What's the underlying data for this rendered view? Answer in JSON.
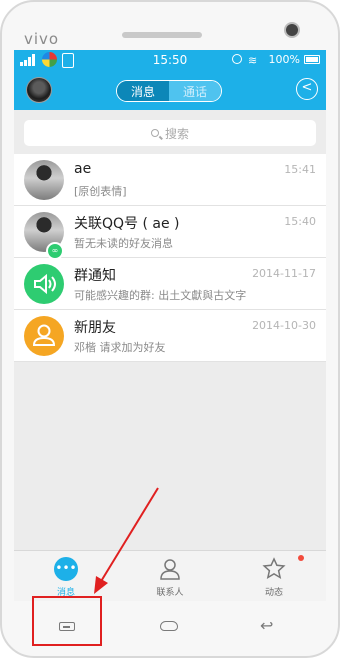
{
  "device": {
    "brand": "vivo"
  },
  "status_bar": {
    "time": "15:50",
    "battery": "100%",
    "wifi_icon": "wifi-icon",
    "alarm_icon": "alarm-icon"
  },
  "header": {
    "tabs": [
      {
        "label": "消息",
        "active": true
      },
      {
        "label": "通话",
        "active": false
      }
    ],
    "back_icon": "back-arrow-icon"
  },
  "search": {
    "placeholder": "搜索"
  },
  "conversations": [
    {
      "title": "ae",
      "subtitle": "[原创表情]",
      "time": "15:41",
      "avatar": "photo"
    },
    {
      "title": "关联QQ号 ( ae )",
      "subtitle": "暂无未读的好友消息",
      "time": "15:40",
      "avatar": "photo-badge",
      "badge_glyph": "∞"
    },
    {
      "title": "群通知",
      "subtitle": "可能感兴趣的群: 出土文獻與古文字",
      "time": "2014-11-17",
      "avatar": "speaker-icon"
    },
    {
      "title": "新朋友",
      "subtitle": "邓楷 请求加为好友",
      "time": "2014-10-30",
      "avatar": "person-icon"
    }
  ],
  "tabbar": [
    {
      "label": "消息",
      "icon": "chat-bubble-icon",
      "active": true
    },
    {
      "label": "联系人",
      "icon": "contact-icon",
      "active": false
    },
    {
      "label": "动态",
      "icon": "star-icon",
      "active": false,
      "has_dot": true
    }
  ],
  "nav_buttons": [
    "menu-icon",
    "home-icon",
    "back-icon"
  ],
  "colors": {
    "accent": "#1db0e8",
    "annotation": "#e02020",
    "group_notice": "#2ecc71",
    "new_friend": "#f5a623",
    "dot": "#f24b3c"
  }
}
